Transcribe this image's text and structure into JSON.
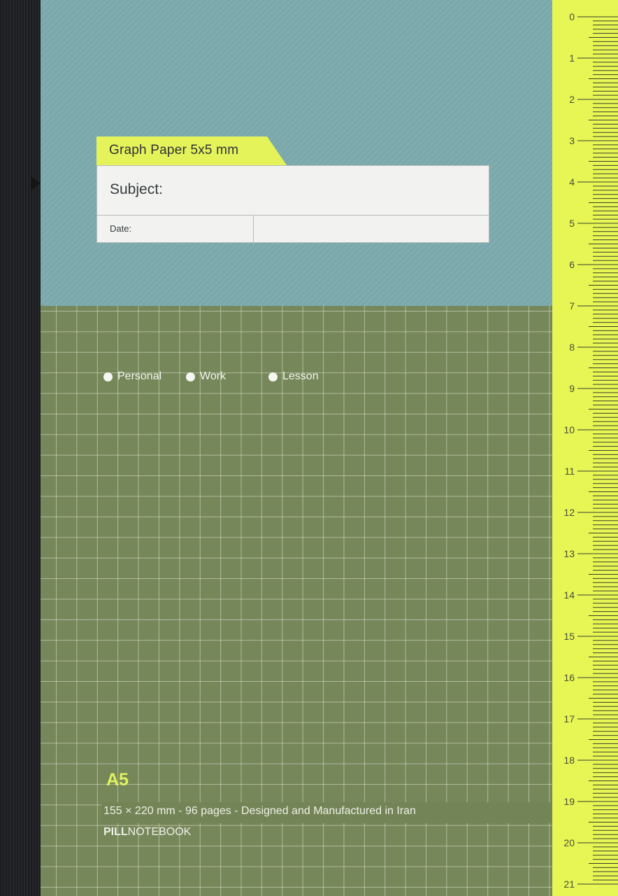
{
  "label": {
    "tab_title": "Graph Paper 5x5 mm",
    "subject_label": "Subject:",
    "date_label": "Date:"
  },
  "options": [
    {
      "label": "Personal"
    },
    {
      "label": "Work"
    },
    {
      "label": "Lesson"
    }
  ],
  "size_badge": "A5",
  "info_line": "155 × 220 mm - 96 pages - Designed and Manufactured in Iran",
  "brand": {
    "bold": "PILL",
    "regular": "NOTEBOOK"
  },
  "ruler": {
    "numbers": [
      "0",
      "1",
      "2",
      "3",
      "4",
      "5",
      "6",
      "7",
      "8",
      "9",
      "10",
      "11",
      "12",
      "13",
      "14",
      "15",
      "16",
      "17",
      "18",
      "19",
      "20",
      "21"
    ]
  },
  "colors": {
    "top_cover": "#7aa8ab",
    "grid_cover": "#76875a",
    "accent_yellow": "#e7f655",
    "spine": "#1e1f21"
  }
}
